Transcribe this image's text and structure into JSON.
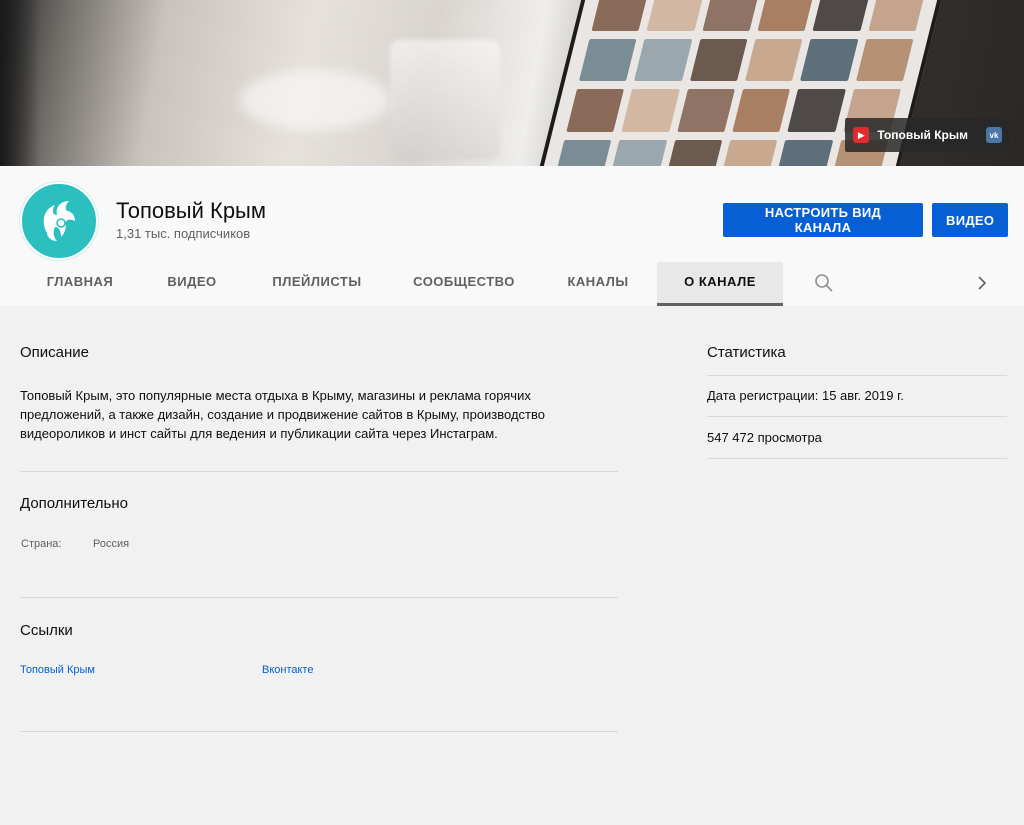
{
  "banner": {
    "link_label": "Топовый Крым",
    "link_icon": "youtube-icon",
    "vk_icon": "vk-icon"
  },
  "channel": {
    "name": "Топовый Крым",
    "subscribers": "1,31 тыс. подписчиков",
    "avatar_color": "#2bbfbf"
  },
  "buttons": {
    "customize": "НАСТРОИТЬ ВИД КАНАЛА",
    "video": "ВИДЕО"
  },
  "tabs": [
    {
      "label": "ГЛАВНАЯ"
    },
    {
      "label": "ВИДЕО"
    },
    {
      "label": "ПЛЕЙЛИСТЫ"
    },
    {
      "label": "СООБЩЕСТВО"
    },
    {
      "label": "КАНАЛЫ"
    },
    {
      "label": "О КАНАЛЕ",
      "active": true
    }
  ],
  "about": {
    "description_title": "Описание",
    "description": "Топовый Крым, это популярные места отдыха в Крыму, магазины и реклама горячих предложений, а также дизайн, создание и продвижение сайтов в Крыму, производство видеороликов и инст сайты для ведения и публикации сайта через Инстаграм.",
    "details_title": "Дополнительно",
    "country_label": "Страна:",
    "country_value": "Россия",
    "links_title": "Ссылки",
    "links": [
      "Топовый Крым",
      "Вконтакте"
    ]
  },
  "stats": {
    "title": "Статистика",
    "joined": "Дата регистрации: 15 авг. 2019 г.",
    "views": "547 472 просмотра"
  },
  "colors": {
    "accent": "#065fd4",
    "page_bg": "#f1f1f1",
    "header_bg": "#f9f9f9"
  }
}
